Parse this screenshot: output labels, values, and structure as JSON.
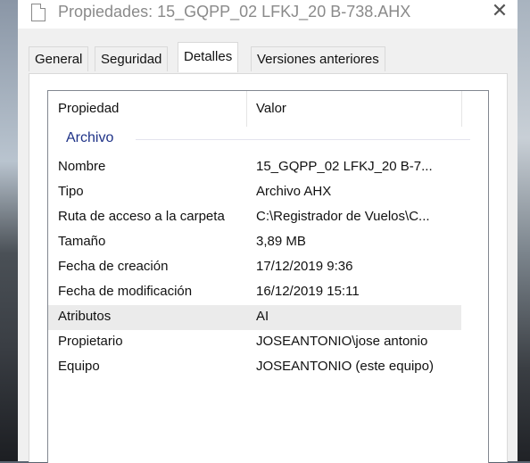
{
  "window": {
    "title": "Propiedades: 15_GQPP_02 LFKJ_20 B-738.AHX",
    "close_glyph": "✕"
  },
  "tabs": [
    {
      "label": "General",
      "active": false
    },
    {
      "label": "Seguridad",
      "active": false
    },
    {
      "label": "Detalles",
      "active": true
    },
    {
      "label": "Versiones anteriores",
      "active": false
    }
  ],
  "details": {
    "columns": {
      "property": "Propiedad",
      "value": "Valor"
    },
    "group": "Archivo",
    "rows": [
      {
        "property": "Nombre",
        "value": "15_GQPP_02 LFKJ_20 B-7..."
      },
      {
        "property": "Tipo",
        "value": "Archivo AHX"
      },
      {
        "property": "Ruta de acceso a la carpeta",
        "value": "C:\\Registrador de Vuelos\\C..."
      },
      {
        "property": "Tamaño",
        "value": "3,89 MB"
      },
      {
        "property": "Fecha de creación",
        "value": "17/12/2019 9:36"
      },
      {
        "property": "Fecha de modificación",
        "value": "16/12/2019 15:11"
      },
      {
        "property": "Atributos",
        "value": "AI"
      },
      {
        "property": "Propietario",
        "value": "JOSEANTONIO\\jose antonio"
      },
      {
        "property": "Equipo",
        "value": "JOSEANTONIO (este equipo)"
      }
    ]
  }
}
